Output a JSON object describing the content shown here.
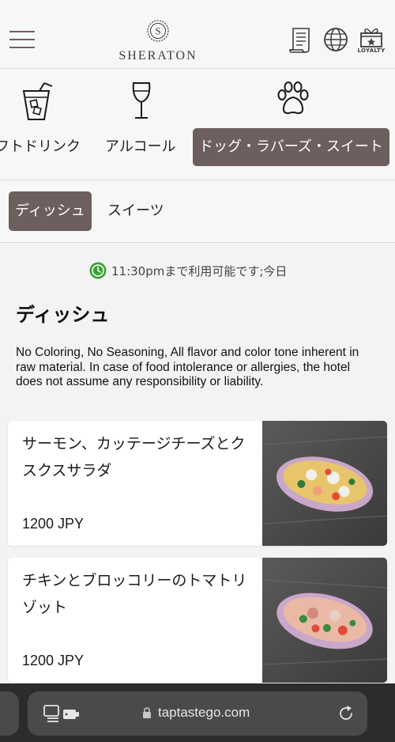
{
  "header": {
    "brand": "SHERATON",
    "loyalty_label": "LOYALTY"
  },
  "categories": [
    {
      "label": "フトドリンク",
      "icon": "soft-drink-icon",
      "active": false
    },
    {
      "label": "アルコール",
      "icon": "wine-glass-icon",
      "active": false
    },
    {
      "label": "ドッグ・ラバーズ・スイート",
      "icon": "paw-icon",
      "active": true
    }
  ],
  "subtabs": [
    {
      "label": "ディッシュ",
      "active": true
    },
    {
      "label": "スイーツ",
      "active": false
    }
  ],
  "availability": "11:30pmまで利用可能です;今日",
  "section": {
    "title": "ディッシュ",
    "notice": "No Coloring, No Seasoning, All flavor and color tone inherent in raw material. In case of food intolerance or allergies, the hotel does not assume any responsibility or liability."
  },
  "items": [
    {
      "name": "サーモン、カッテージチーズとクスクスサラダ",
      "price": "1200 JPY"
    },
    {
      "name": "チキンとブロッコリーのトマトリゾット",
      "price": "1200 JPY"
    }
  ],
  "browser": {
    "url": "taptastego.com"
  },
  "colors": {
    "accent": "#6d5f5d",
    "availability_icon": "#3aa335",
    "browser_bar": "#2c2c2e"
  }
}
